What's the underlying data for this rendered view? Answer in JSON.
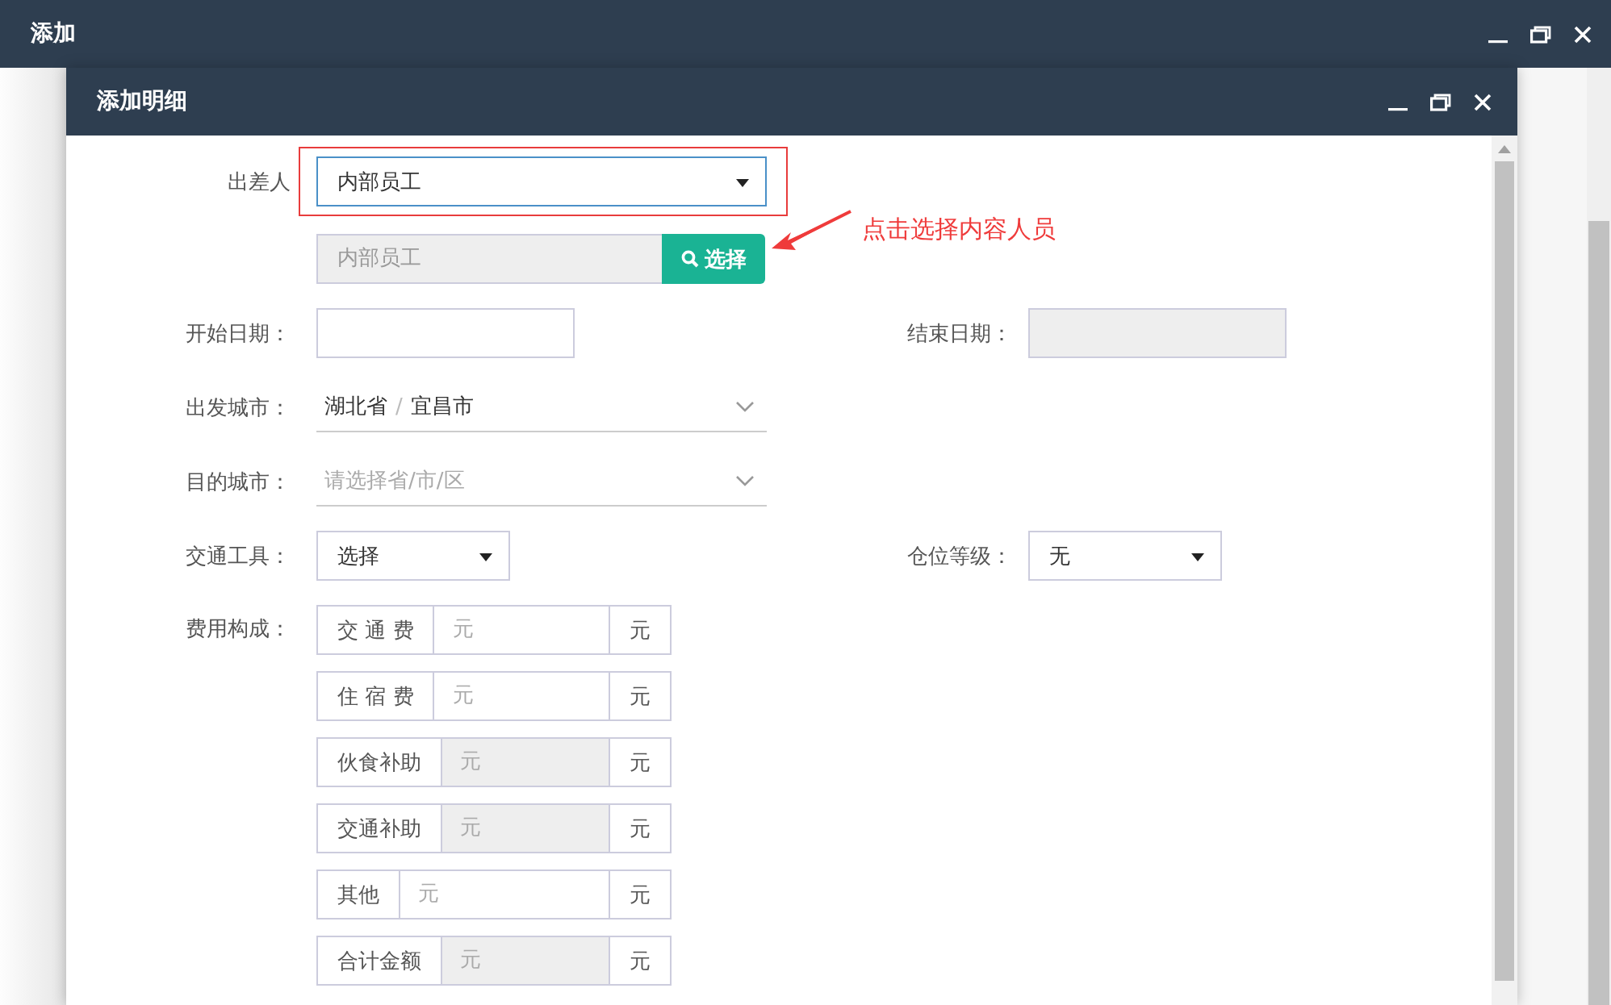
{
  "window": {
    "title": "添加"
  },
  "dialog": {
    "title": "添加明细"
  },
  "traveler": {
    "label": "出差人",
    "value": "内部员工",
    "highlighted": true
  },
  "picker": {
    "placeholder": "内部员工",
    "button": "选择"
  },
  "annotation": {
    "text": "点击选择内容人员"
  },
  "start_date": {
    "label": "开始日期：",
    "disabled": false
  },
  "end_date": {
    "label": "结束日期：",
    "disabled": true
  },
  "departure": {
    "label": "出发城市：",
    "province": "湖北省",
    "separator": "/",
    "city": "宜昌市"
  },
  "destination": {
    "label": "目的城市：",
    "placeholder": "请选择省/市/区"
  },
  "transport": {
    "label": "交通工具：",
    "value": "选择"
  },
  "cabin": {
    "label": "仓位等级：",
    "value": "无"
  },
  "costs": {
    "label": "费用构成：",
    "items": [
      {
        "name": "交 通 费",
        "placeholder": "元",
        "unit": "元",
        "disabled": false
      },
      {
        "name": "住 宿 费",
        "placeholder": "元",
        "unit": "元",
        "disabled": false
      },
      {
        "name": "伙食补助",
        "placeholder": "元",
        "unit": "元",
        "disabled": true
      },
      {
        "name": "交通补助",
        "placeholder": "元",
        "unit": "元",
        "disabled": true
      },
      {
        "name": "其他",
        "placeholder": "元",
        "unit": "元",
        "disabled": false
      },
      {
        "name": "合计金额",
        "placeholder": "元",
        "unit": "元",
        "disabled": true
      }
    ]
  }
}
